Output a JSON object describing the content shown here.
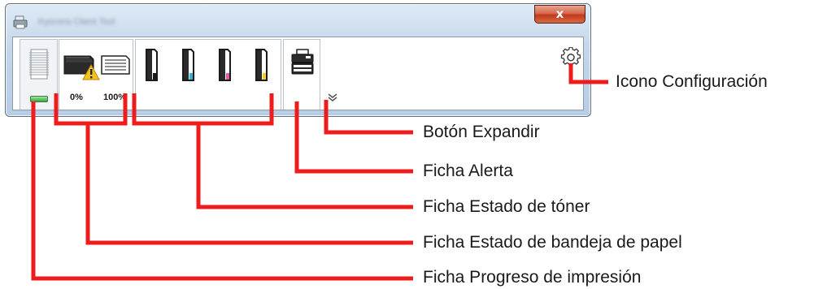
{
  "window": {
    "title": "Kyocera Client Tool",
    "close_glyph": "x"
  },
  "tabs": {
    "paper_tray": {
      "percent_left": "0%",
      "percent_right": "100%"
    }
  },
  "icons": {
    "app": "printer-app-icon",
    "progress": "print-progress-icon",
    "paper_tray": "paper-tray-icon",
    "warning": "warning-triangle-icon",
    "toner": "toner-cartridge-icon",
    "alert": "printer-alert-icon",
    "settings": "gear-icon",
    "expand": "chevron-down-icon"
  },
  "toner_colors": [
    "#1a1a1a",
    "#2fb3e0",
    "#e05aa0",
    "#f2d21a"
  ],
  "callout_color": "#ee1c1c",
  "callouts": {
    "settings": "Icono Configuración",
    "expand": "Botón Expandir",
    "alert": "Ficha Alerta",
    "toner": "Ficha Estado de tóner",
    "paper_tray": "Ficha Estado de bandeja de papel",
    "progress": "Ficha Progreso de impresión"
  }
}
